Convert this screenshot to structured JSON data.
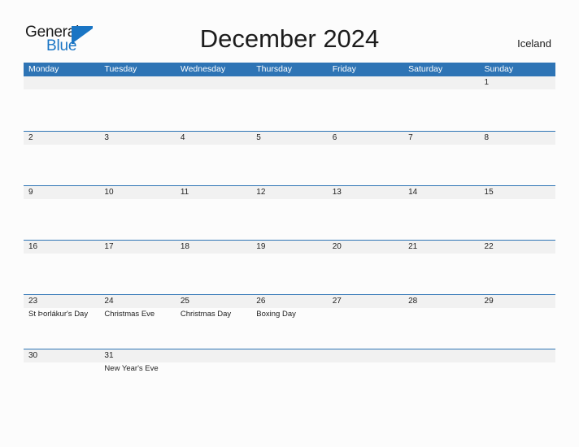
{
  "brand": {
    "name_part1": "General",
    "name_part2": "Blue",
    "flag_icon": "blue-triangle-flag",
    "accent_color": "#1a75c4"
  },
  "header": {
    "title": "December 2024",
    "country": "Iceland"
  },
  "theme": {
    "header_blue": "#2e74b5",
    "band_gray": "#f1f1f1",
    "page_background": "#fcfcfc",
    "text_color": "#222222"
  },
  "calendar": {
    "weekdays": [
      "Monday",
      "Tuesday",
      "Wednesday",
      "Thursday",
      "Friday",
      "Saturday",
      "Sunday"
    ],
    "weeks": [
      [
        {
          "day": "",
          "event": ""
        },
        {
          "day": "",
          "event": ""
        },
        {
          "day": "",
          "event": ""
        },
        {
          "day": "",
          "event": ""
        },
        {
          "day": "",
          "event": ""
        },
        {
          "day": "",
          "event": ""
        },
        {
          "day": "1",
          "event": ""
        }
      ],
      [
        {
          "day": "2",
          "event": ""
        },
        {
          "day": "3",
          "event": ""
        },
        {
          "day": "4",
          "event": ""
        },
        {
          "day": "5",
          "event": ""
        },
        {
          "day": "6",
          "event": ""
        },
        {
          "day": "7",
          "event": ""
        },
        {
          "day": "8",
          "event": ""
        }
      ],
      [
        {
          "day": "9",
          "event": ""
        },
        {
          "day": "10",
          "event": ""
        },
        {
          "day": "11",
          "event": ""
        },
        {
          "day": "12",
          "event": ""
        },
        {
          "day": "13",
          "event": ""
        },
        {
          "day": "14",
          "event": ""
        },
        {
          "day": "15",
          "event": ""
        }
      ],
      [
        {
          "day": "16",
          "event": ""
        },
        {
          "day": "17",
          "event": ""
        },
        {
          "day": "18",
          "event": ""
        },
        {
          "day": "19",
          "event": ""
        },
        {
          "day": "20",
          "event": ""
        },
        {
          "day": "21",
          "event": ""
        },
        {
          "day": "22",
          "event": ""
        }
      ],
      [
        {
          "day": "23",
          "event": "St Þorlákur's Day"
        },
        {
          "day": "24",
          "event": "Christmas Eve"
        },
        {
          "day": "25",
          "event": "Christmas Day"
        },
        {
          "day": "26",
          "event": "Boxing Day"
        },
        {
          "day": "27",
          "event": ""
        },
        {
          "day": "28",
          "event": ""
        },
        {
          "day": "29",
          "event": ""
        }
      ],
      [
        {
          "day": "30",
          "event": ""
        },
        {
          "day": "31",
          "event": "New Year's Eve"
        },
        {
          "day": "",
          "event": ""
        },
        {
          "day": "",
          "event": ""
        },
        {
          "day": "",
          "event": ""
        },
        {
          "day": "",
          "event": ""
        },
        {
          "day": "",
          "event": ""
        }
      ]
    ]
  }
}
